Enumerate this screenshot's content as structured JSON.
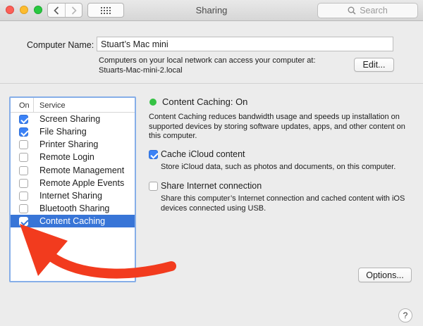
{
  "window": {
    "title": "Sharing",
    "search_placeholder": "Search"
  },
  "computer_name": {
    "label": "Computer Name:",
    "value": "Stuart’s Mac mini",
    "description_line1": "Computers on your local network can access your computer at:",
    "description_line2": "Stuarts-Mac-mini-2.local",
    "edit_label": "Edit..."
  },
  "service_list": {
    "header_on": "On",
    "header_service": "Service",
    "items": [
      {
        "label": "Screen Sharing",
        "checked": true,
        "selected": false
      },
      {
        "label": "File Sharing",
        "checked": true,
        "selected": false
      },
      {
        "label": "Printer Sharing",
        "checked": false,
        "selected": false
      },
      {
        "label": "Remote Login",
        "checked": false,
        "selected": false
      },
      {
        "label": "Remote Management",
        "checked": false,
        "selected": false
      },
      {
        "label": "Remote Apple Events",
        "checked": false,
        "selected": false
      },
      {
        "label": "Internet Sharing",
        "checked": false,
        "selected": false
      },
      {
        "label": "Bluetooth Sharing",
        "checked": false,
        "selected": false
      },
      {
        "label": "Content Caching",
        "checked": true,
        "selected": true
      }
    ]
  },
  "detail": {
    "status": "Content Caching: On",
    "status_color": "#35c244",
    "description_line1": "Content Caching reduces bandwidth usage and speeds up installation on",
    "description_line2": "supported devices by storing software updates, apps, and other content on",
    "description_line3": "this computer.",
    "cache_icloud": {
      "label": "Cache iCloud content",
      "checked": true,
      "description": "Store iCloud data, such as photos and documents, on this computer."
    },
    "share_internet": {
      "label": "Share Internet connection",
      "checked": false,
      "description_line1": "Share this computer’s Internet connection and cached content with iOS",
      "description_line2": "devices connected using USB."
    },
    "options_label": "Options...",
    "help_label": "?"
  },
  "colors": {
    "selection": "#3875d7",
    "checkbox_checked": "#3b82f6",
    "annotation_arrow": "#f23b1e"
  },
  "icons": [
    "back-chevron-icon",
    "forward-chevron-icon",
    "grid-icon",
    "search-icon",
    "annotation-arrow-icon"
  ]
}
